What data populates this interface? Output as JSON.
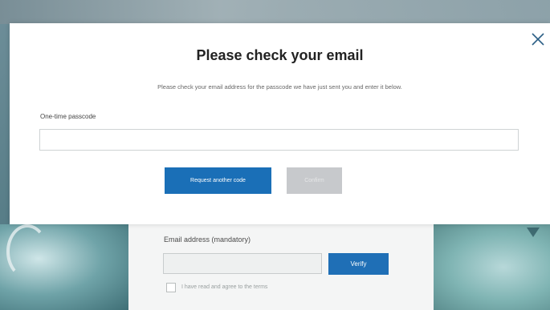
{
  "modal": {
    "title": "Please check your email",
    "description": "Please check your email address for the passcode we have just sent you and enter it below.",
    "code_label": "One-time passcode",
    "code_value": "",
    "request_button_label": "Request another code",
    "confirm_button_label": "Confirm",
    "close_icon": "close-icon"
  },
  "background_form": {
    "email_label": "Email address (mandatory)",
    "email_value": "",
    "verify_button_label": "Verify",
    "checkbox_label": "I have read and agree to the terms"
  },
  "colors": {
    "primary_button": "#1a6fb7",
    "disabled_button": "#c7c9cc",
    "modal_background": "#ffffff"
  }
}
